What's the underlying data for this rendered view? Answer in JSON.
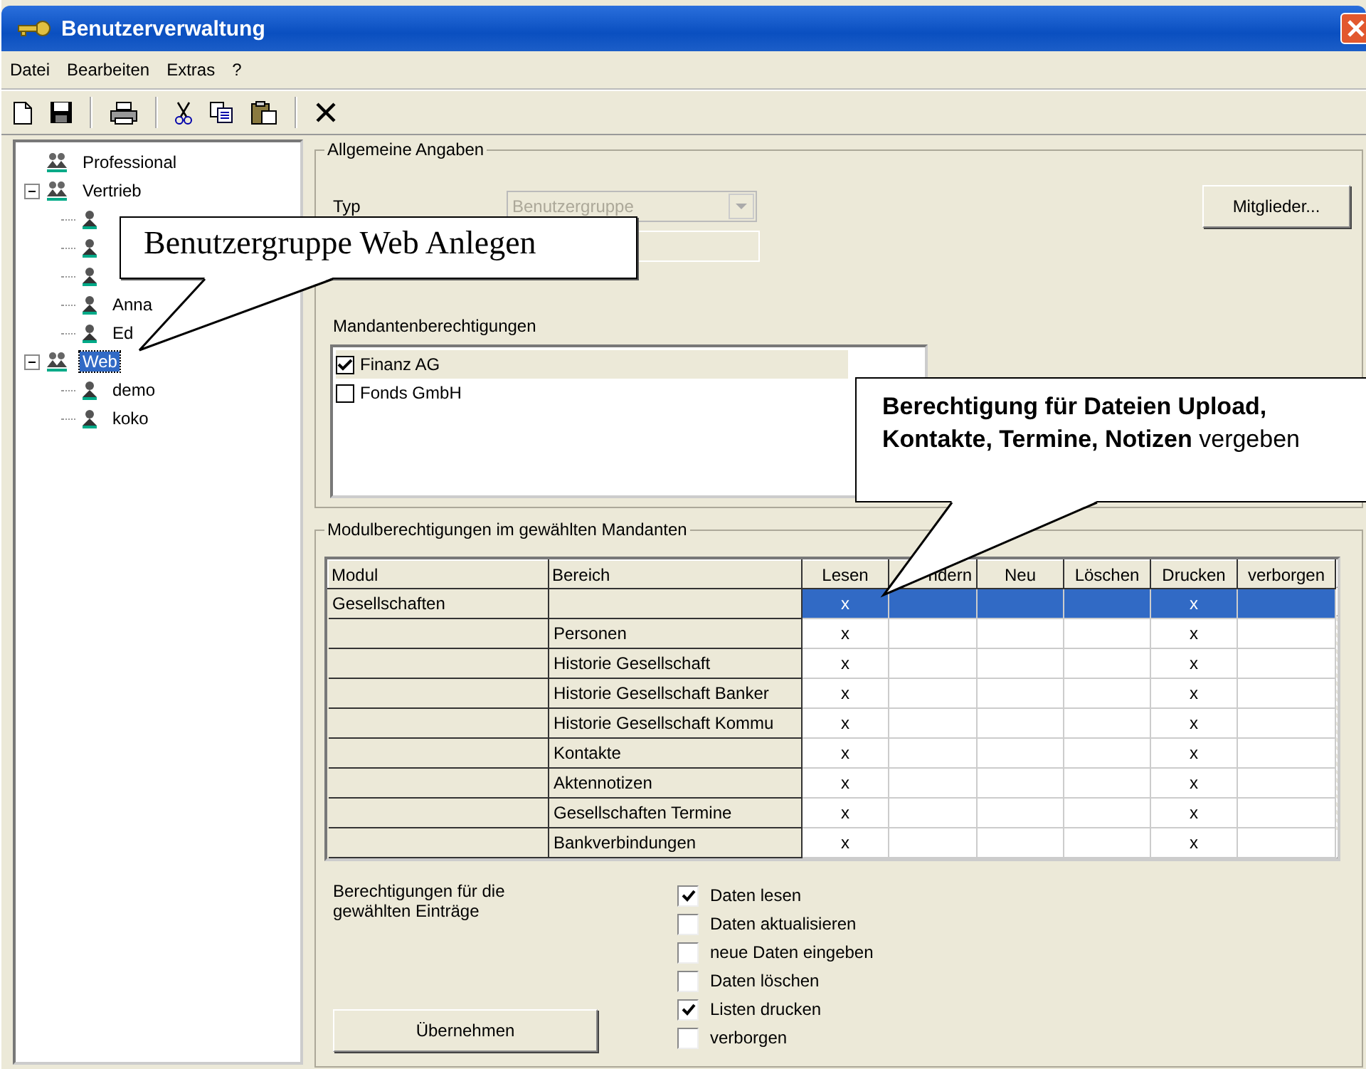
{
  "window": {
    "title": "Benutzerverwaltung"
  },
  "menu": [
    "Datei",
    "Bearbeiten",
    "Extras",
    "?"
  ],
  "toolbar": [
    {
      "kind": "new"
    },
    {
      "kind": "save"
    },
    {
      "kind": "separator"
    },
    {
      "kind": "print"
    },
    {
      "kind": "separator"
    },
    {
      "kind": "cut"
    },
    {
      "kind": "copy"
    },
    {
      "kind": "paste"
    },
    {
      "kind": "separator"
    },
    {
      "kind": "delete"
    }
  ],
  "tree": [
    {
      "label": "Professional",
      "kind": "group",
      "selected": false
    },
    {
      "label": "Vertrieb",
      "kind": "group",
      "selected": false,
      "expanded": true,
      "children": [
        {
          "kind": "user",
          "selected": false
        },
        {
          "kind": "user",
          "selected": false
        },
        {
          "kind": "user",
          "selected": false
        },
        {
          "label": "Anna",
          "kind": "user",
          "selected": false
        },
        {
          "label": "Ed",
          "kind": "user",
          "selected": false
        }
      ]
    },
    {
      "label": "Web",
      "kind": "group",
      "selected": true,
      "expanded": true,
      "children": [
        {
          "label": "demo",
          "kind": "user",
          "selected": false
        },
        {
          "label": "koko",
          "kind": "user",
          "selected": false
        }
      ]
    }
  ],
  "general": {
    "legend": "Allgemeine Angaben",
    "type_label": "Typ",
    "type_value": "Benutzergruppe",
    "type_disabled": true,
    "members_button": "Mitglieder...",
    "clients_label": "Mandantenberechtigungen",
    "clients": [
      {
        "label": "Finanz AG",
        "checked": true,
        "selected": true
      },
      {
        "label": "Fonds GmbH",
        "checked": false,
        "selected": false
      }
    ]
  },
  "modules": {
    "legend": "Modulberechtigungen im gewählten Mandanten",
    "columns": [
      "Modul",
      "Bereich",
      "Lesen",
      "ndern",
      "Neu",
      "Löschen",
      "Drucken",
      "verborgen"
    ],
    "rows": [
      {
        "modul": "Gesellschaften",
        "selected": true,
        "cells": [
          "x",
          null,
          null,
          null,
          "x",
          null
        ]
      },
      {
        "bereich": "Personen",
        "selected": false,
        "cells": [
          "x",
          null,
          null,
          null,
          "x",
          null
        ]
      },
      {
        "bereich": "Historie Gesellschaft",
        "selected": false,
        "cells": [
          "x",
          null,
          null,
          null,
          "x",
          null
        ]
      },
      {
        "bereich": "Historie Gesellschaft Banker",
        "selected": false,
        "cells": [
          "x",
          null,
          null,
          null,
          "x",
          null
        ]
      },
      {
        "bereich": "Historie Gesellschaft Kommu",
        "selected": false,
        "cells": [
          "x",
          null,
          null,
          null,
          "x",
          null
        ]
      },
      {
        "bereich": "Kontakte",
        "selected": false,
        "cells": [
          "x",
          null,
          null,
          null,
          "x",
          null
        ]
      },
      {
        "bereich": "Aktennotizen",
        "selected": false,
        "cells": [
          "x",
          null,
          null,
          null,
          "x",
          null
        ]
      },
      {
        "bereich": "Gesellschaften Termine",
        "selected": false,
        "cells": [
          "x",
          null,
          null,
          null,
          "x",
          null
        ]
      },
      {
        "bereich": "Bankverbindungen",
        "selected": false,
        "cells": [
          "x",
          null,
          null,
          null,
          "x",
          null
        ]
      }
    ],
    "entries_label": "Berechtigungen für die gewählten Einträge",
    "apply_button": "Übernehmen",
    "options": [
      {
        "label": "Daten lesen",
        "checked": true
      },
      {
        "label": "Daten aktualisieren",
        "checked": false
      },
      {
        "label": "neue Daten eingeben",
        "checked": false
      },
      {
        "label": "Daten löschen",
        "checked": false
      },
      {
        "label": "Listen drucken",
        "checked": true
      },
      {
        "label": "verborgen",
        "checked": false
      }
    ]
  },
  "callouts": [
    {
      "kind": "serif",
      "text": "Benutzergruppe Web Anlegen"
    },
    {
      "kind": "sans",
      "text": "**Berechtigung für Dateien Upload, Kontakte, Termine, Notizen** vergeben"
    }
  ]
}
